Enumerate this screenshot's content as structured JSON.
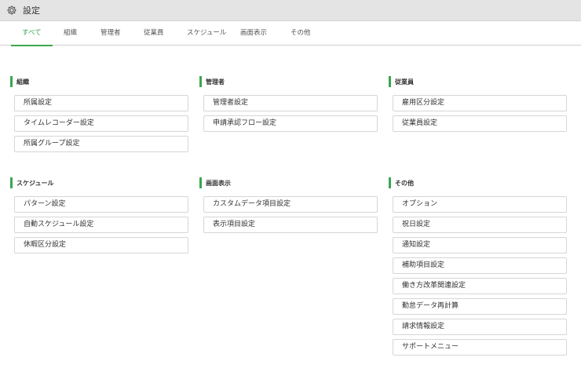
{
  "window": {
    "title": "設定",
    "icon": "gear-icon"
  },
  "tabs": [
    {
      "label": "すべて",
      "active": true
    },
    {
      "label": "組織"
    },
    {
      "label": "管理者"
    },
    {
      "label": "従業員"
    },
    {
      "label": "スケジュール"
    },
    {
      "label": "画面表示"
    },
    {
      "label": "その他"
    }
  ],
  "accent_color": "#3aa652",
  "sections": [
    {
      "heading": "組織",
      "items": [
        "所属設定",
        "タイムレコーダー設定",
        "所属グループ設定"
      ]
    },
    {
      "heading": "管理者",
      "items": [
        "管理者設定",
        "申請承認フロー設定"
      ]
    },
    {
      "heading": "従業員",
      "items": [
        "雇用区分設定",
        "従業員設定"
      ]
    },
    {
      "heading": "スケジュール",
      "items": [
        "パターン設定",
        "自動スケジュール設定",
        "休暇区分設定"
      ]
    },
    {
      "heading": "画面表示",
      "items": [
        "カスタムデータ項目設定",
        "表示項目設定"
      ]
    },
    {
      "heading": "その他",
      "items": [
        "オプション",
        "祝日設定",
        "通知設定",
        "補助項目設定",
        "働き方改革関連設定",
        "勤怠データ再計算",
        "請求情報設定",
        "サポートメニュー"
      ]
    }
  ]
}
